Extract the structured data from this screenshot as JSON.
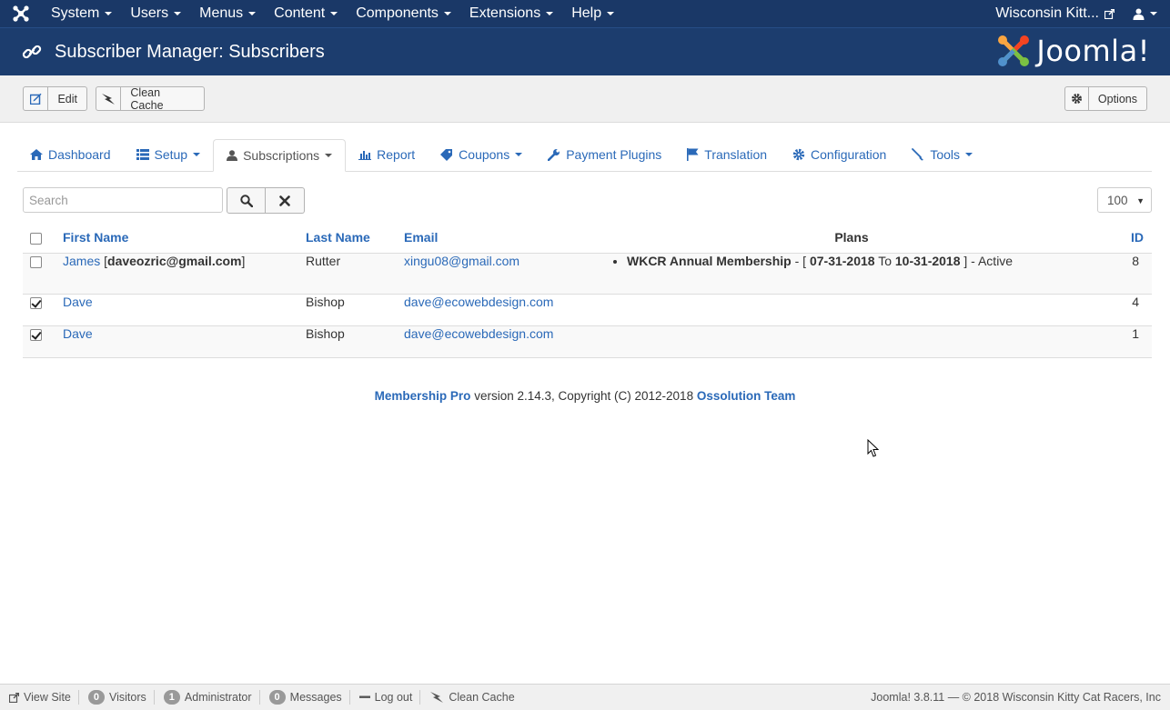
{
  "topnav": {
    "menus": [
      {
        "label": "System"
      },
      {
        "label": "Users"
      },
      {
        "label": "Menus"
      },
      {
        "label": "Content"
      },
      {
        "label": "Components"
      },
      {
        "label": "Extensions"
      },
      {
        "label": "Help"
      }
    ],
    "site_name": "Wisconsin Kitt...",
    "user_icon": "user-icon"
  },
  "header": {
    "title": "Subscriber Manager: Subscribers",
    "icon": "link-icon",
    "brand": "Joomla!"
  },
  "toolbar": {
    "edit_label": "Edit",
    "clean_cache_label": "Clean Cache",
    "options_label": "Options"
  },
  "tabs": [
    {
      "label": "Dashboard",
      "icon": "home-icon"
    },
    {
      "label": "Setup",
      "icon": "list-icon"
    },
    {
      "label": "Subscriptions",
      "icon": "user-icon",
      "active": true
    },
    {
      "label": "Report",
      "icon": "bar-chart-icon"
    },
    {
      "label": "Coupons",
      "icon": "tag-icon"
    },
    {
      "label": "Payment Plugins",
      "icon": "wrench-icon"
    },
    {
      "label": "Translation",
      "icon": "flag-icon"
    },
    {
      "label": "Configuration",
      "icon": "gear-icon"
    },
    {
      "label": "Tools",
      "icon": "brush-icon"
    }
  ],
  "filters": {
    "search_placeholder": "Search",
    "search_value": "",
    "limit": "100"
  },
  "table": {
    "columns": [
      "First Name",
      "Last Name",
      "Email",
      "Plans",
      "ID"
    ],
    "rows": [
      {
        "checked": false,
        "first_name": "James",
        "first_name_extra": "daveozric@gmail.com",
        "last_name": "Rutter",
        "email": "xingu08@gmail.com",
        "plan_name": "WKCR Annual Membership",
        "plan_sep": " - [ ",
        "plan_from": "07-31-2018",
        "plan_to_word": " To ",
        "plan_to": "10-31-2018",
        "plan_status": " ] - Active",
        "id": "8"
      },
      {
        "checked": true,
        "first_name": "Dave",
        "last_name": "Bishop",
        "email": "dave@ecowebdesign.com",
        "id": "4"
      },
      {
        "checked": true,
        "first_name": "Dave",
        "last_name": "Bishop",
        "email": "dave@ecowebdesign.com",
        "id": "1"
      }
    ]
  },
  "credit": {
    "product": "Membership Pro",
    "text": " version 2.14.3, Copyright (C) 2012-2018 ",
    "team": "Ossolution Team"
  },
  "statusbar": {
    "view_site": "View Site",
    "visitors_count": "0",
    "visitors_label": "Visitors",
    "admin_count": "1",
    "admin_label": "Administrator",
    "messages_count": "0",
    "messages_label": "Messages",
    "logout": "Log out",
    "clean_cache": "Clean Cache",
    "version": "Joomla! 3.8.11  —  © 2018 Wisconsin Kitty Cat Racers, Inc"
  },
  "colors": {
    "nav_bg": "#1a3867",
    "header_bg": "#1c3d6e",
    "link": "#2a69b8"
  }
}
